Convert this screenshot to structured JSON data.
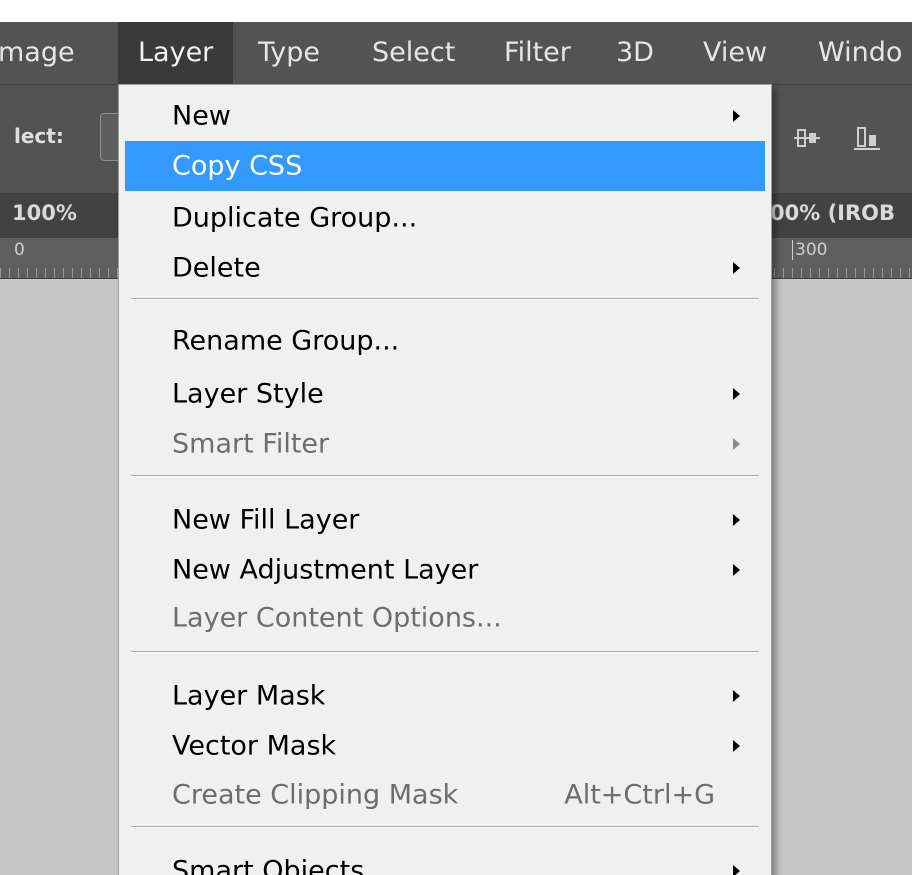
{
  "menubar": {
    "items": [
      {
        "label": "mage",
        "active": false
      },
      {
        "label": "Layer",
        "active": true
      },
      {
        "label": "Type",
        "active": false
      },
      {
        "label": "Select",
        "active": false
      },
      {
        "label": "Filter",
        "active": false
      },
      {
        "label": "3D",
        "active": false
      },
      {
        "label": "View",
        "active": false
      },
      {
        "label": "Windo",
        "active": false
      }
    ]
  },
  "options_bar": {
    "label": "lect:"
  },
  "document": {
    "tab_left": "100%",
    "tab_right": "00% (IROB"
  },
  "ruler": {
    "left_number": "0",
    "right_number": "300"
  },
  "layer_menu": {
    "items": [
      {
        "label": "New",
        "submenu": true,
        "disabled": false,
        "highlighted": false
      },
      {
        "label": "Copy CSS",
        "submenu": false,
        "disabled": false,
        "highlighted": true
      },
      {
        "label": "Duplicate Group...",
        "submenu": false,
        "disabled": false,
        "highlighted": false
      },
      {
        "label": "Delete",
        "submenu": true,
        "disabled": false,
        "highlighted": false
      },
      {
        "label": "Rename Group...",
        "submenu": false,
        "disabled": false,
        "highlighted": false
      },
      {
        "label": "Layer Style",
        "submenu": true,
        "disabled": false,
        "highlighted": false
      },
      {
        "label": "Smart Filter",
        "submenu": true,
        "disabled": true,
        "highlighted": false
      },
      {
        "label": "New Fill Layer",
        "submenu": true,
        "disabled": false,
        "highlighted": false
      },
      {
        "label": "New Adjustment Layer",
        "submenu": true,
        "disabled": false,
        "highlighted": false
      },
      {
        "label": "Layer Content Options...",
        "submenu": false,
        "disabled": true,
        "highlighted": false
      },
      {
        "label": "Layer Mask",
        "submenu": true,
        "disabled": false,
        "highlighted": false
      },
      {
        "label": "Vector Mask",
        "submenu": true,
        "disabled": false,
        "highlighted": false
      },
      {
        "label": "Create Clipping Mask",
        "submenu": false,
        "disabled": true,
        "highlighted": false,
        "shortcut": "Alt+Ctrl+G"
      },
      {
        "label": "Smart Objects",
        "submenu": true,
        "disabled": false,
        "highlighted": false
      }
    ]
  },
  "colors": {
    "highlight": "#3399ff",
    "menubar_bg": "#535353",
    "menu_bg": "#f0f0f0",
    "canvas_bg": "#c6c6c6"
  }
}
